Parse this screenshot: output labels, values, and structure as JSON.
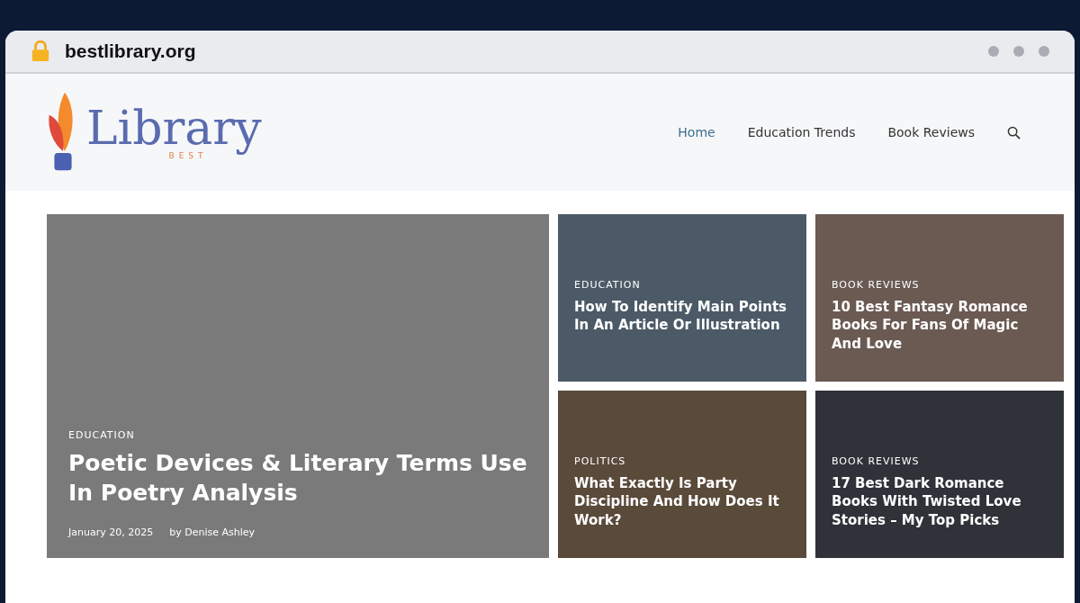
{
  "browser": {
    "address": "bestlibrary.org"
  },
  "logo": {
    "name": "Library",
    "tagline": "BEST"
  },
  "nav": [
    {
      "label": "Home",
      "selected": true
    },
    {
      "label": "Education Trends",
      "selected": false
    },
    {
      "label": "Book Reviews",
      "selected": false
    }
  ],
  "featured": {
    "category": "EDUCATION",
    "title": "Poetic Devices & Literary Terms Use In Poetry Analysis",
    "date": "January 20, 2025",
    "author": "by Denise Ashley"
  },
  "posts": [
    {
      "category": "EDUCATION",
      "title": "How To Identify Main Points In An Article Or Illustration"
    },
    {
      "category": "BOOK REVIEWS",
      "title": "10 Best Fantasy Romance Books For Fans Of Magic And Love"
    },
    {
      "category": "POLITICS",
      "title": "What Exactly Is Party Discipline And How Does It Work?"
    },
    {
      "category": "BOOK REVIEWS",
      "title": "17 Best Dark Romance Books With Twisted Love Stories – My Top Picks"
    }
  ]
}
